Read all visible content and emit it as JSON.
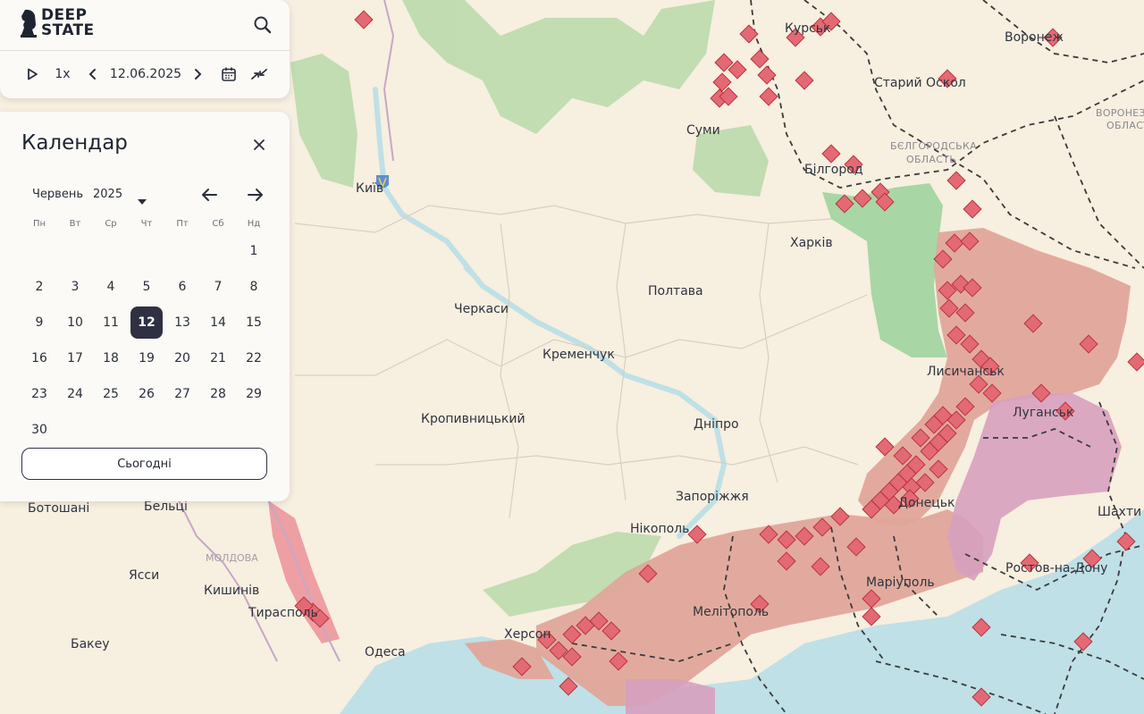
{
  "app": {
    "logo_line1": "DEEP",
    "logo_line2": "STATE"
  },
  "toolbar": {
    "speed": "1x",
    "date": "12.06.2025",
    "icons": [
      "play-icon",
      "chevron-left-icon",
      "chevron-right-icon",
      "calendar-icon",
      "collapse-arrows-icon",
      "search-icon"
    ]
  },
  "calendar": {
    "title": "Календар",
    "month": "Червень",
    "year": "2025",
    "weekdays": [
      "Пн",
      "Вт",
      "Ср",
      "Чт",
      "Пт",
      "Сб",
      "Нд"
    ],
    "days": [
      "1",
      "2",
      "3",
      "4",
      "5",
      "6",
      "7",
      "8",
      "9",
      "10",
      "11",
      "12",
      "13",
      "14",
      "15",
      "16",
      "17",
      "18",
      "19",
      "20",
      "21",
      "22",
      "23",
      "24",
      "25",
      "26",
      "27",
      "28",
      "29",
      "30"
    ],
    "first_weekday_index": 6,
    "selected_day": "12",
    "today_label": "Сьогодні"
  },
  "map": {
    "colors": {
      "land": "#f7efe0",
      "water": "#bfe0e6",
      "forest": "#b7d8a8",
      "occupied": "#e0a59a",
      "occupied_before": "#d7a0be",
      "liberated": "#a9d6a5",
      "contested_marker": "#e36a74",
      "border": "#444"
    },
    "cities": {
      "kursk": "Курськ",
      "voronezh": "Воронеж",
      "staryi_oskol": "Старий Оскол",
      "sumy": "Суми",
      "bilgorod": "Білгород",
      "kyiv": "Київ",
      "kharkiv": "Харків",
      "poltava": "Полтава",
      "cherkasy": "Черкаси",
      "kremenchuk": "Кременчук",
      "lysychansk": "Лисичанськ",
      "luhansk": "Луганськ",
      "kropyvnytskyi": "Кропивницький",
      "dnipro": "Дніпро",
      "zaporizhzhia": "Запоріжжя",
      "donetsk": "Донецьк",
      "shakhty": "Шахти",
      "botoshani": "Ботошані",
      "beltsy": "Бельці",
      "nikopol": "Нікополь",
      "yassy": "Ясси",
      "chisinau": "Кишинів",
      "tiraspol": "Тирасполь",
      "rostov": "Ростов-на-Дону",
      "mariupol": "Маріуполь",
      "melitopol": "Мелітополь",
      "bakeu": "Бакеу",
      "kherson": "Херсон",
      "odesa": "Одеса"
    },
    "regions": {
      "belgorod_line1": "БЄЛГОРОДСЬКА",
      "belgorod_line2": "ОБЛАСТЬ",
      "voronezh_line1": "ВОРОНЕЗЬКА",
      "voronezh_line2": "ОБЛАСТЬ",
      "moldova": "МОЛДОВА"
    }
  }
}
